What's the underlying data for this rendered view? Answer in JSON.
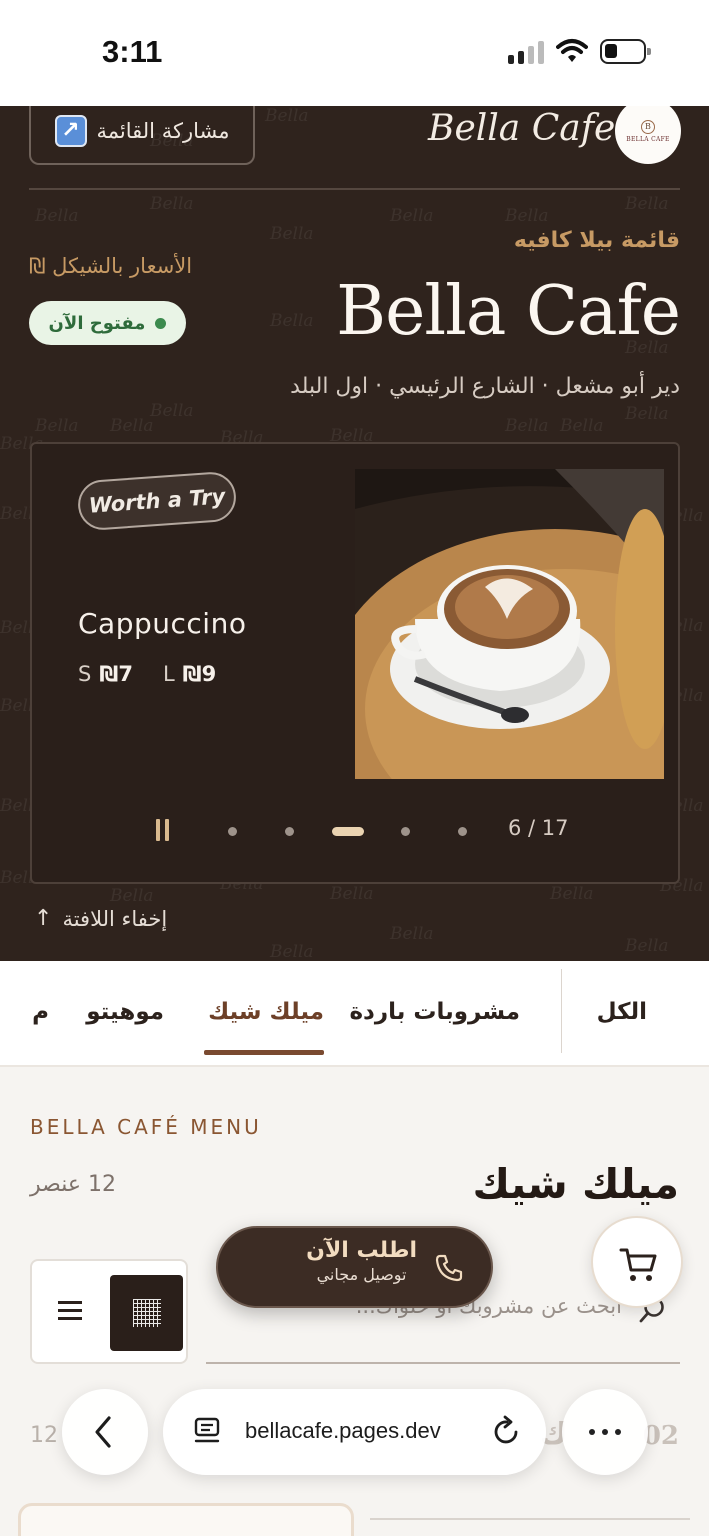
{
  "status_bar": {
    "time": "3:11"
  },
  "header": {
    "share_label": "مشاركة القائمة",
    "brand": "Bella Cafe",
    "logo_text": "BELLA CAFE",
    "logo_letter": "B"
  },
  "hero": {
    "menu_subtitle": "قائمة بيلا كافيه",
    "currency_note": "الأسعار بالشيكل ₪",
    "open_status": "مفتوح الآن",
    "title": "Bella Cafe",
    "address": "دير أبو مشعل · الشارع الرئيسي · اول البلد",
    "watermark": "Bella"
  },
  "carousel": {
    "badge": "Worth a Try",
    "product_name": "Cappuccino",
    "sizes": [
      {
        "size": "S",
        "price": "₪7"
      },
      {
        "size": "L",
        "price": "₪9"
      }
    ],
    "counter": "6 / 17",
    "hide_banner": "إخفاء اللافتة"
  },
  "tabs": [
    {
      "label": "الكل",
      "active": false
    },
    {
      "label": "مشروبات باردة",
      "active": false
    },
    {
      "label": "ميلك شيك",
      "active": true
    },
    {
      "label": "موهيتو",
      "active": false
    },
    {
      "label": "م",
      "active": false
    }
  ],
  "section": {
    "kicker": "BELLA CAFÉ MENU",
    "title": "ميلك شيك",
    "count": "12 عنصر"
  },
  "search": {
    "placeholder": "ابحث عن مشروبك أو حلواك..."
  },
  "order": {
    "main": "اطلب الآن",
    "sub": "توصيل مجاني"
  },
  "browser": {
    "url": "bellacafe.pages.dev"
  },
  "peek": {
    "left": "12",
    "right": "02",
    "mid": "ك"
  },
  "colors": {
    "hero_bg": "#2f231d",
    "accent": "#c79a64",
    "tab_active": "#7a4a30",
    "open_green": "#2e6b3b"
  }
}
